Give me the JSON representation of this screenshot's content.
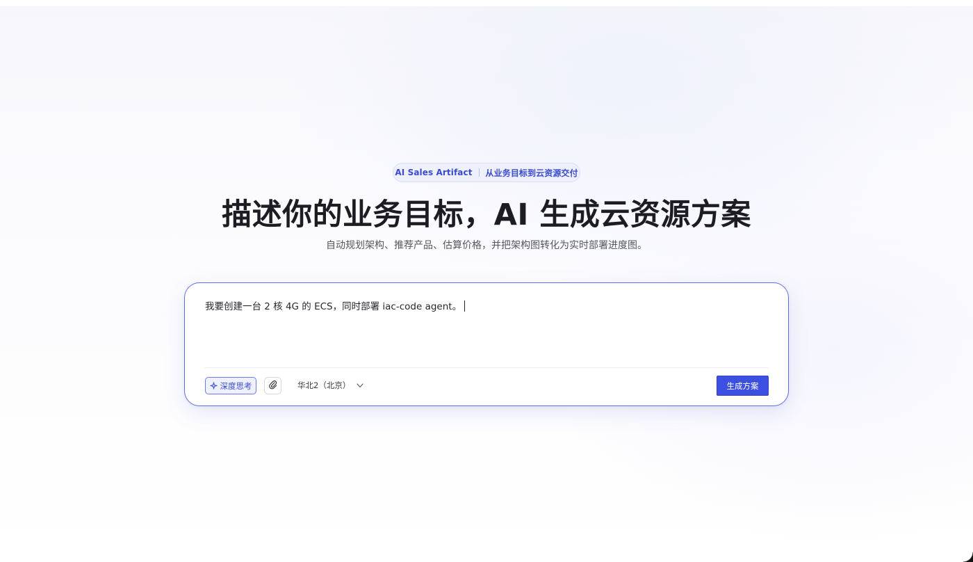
{
  "hero": {
    "pill": {
      "brand": "AI Sales Artifact",
      "tagline": "从业务目标到云资源交付"
    },
    "title": "描述你的业务目标，AI 生成云资源方案",
    "subtitle": "自动规划架构、推荐产品、估算价格，并把架构图转化为实时部署进度图。"
  },
  "composer": {
    "prompt_value": "我要创建一台 2 核 4G 的 ECS，同时部署 iac-code agent。",
    "deep_think_label": "深度思考",
    "region_selected": "华北2（北京）",
    "generate_label": "生成方案"
  },
  "icons": {
    "deep_think": "sparkle-icon",
    "attach": "paperclip-icon",
    "region_dropdown": "chevron-down-icon"
  },
  "colors": {
    "accent": "#3d4fe0",
    "composer_border": "#5d6ee6",
    "pill_background": "#eef0fb",
    "pill_text": "#3a4bd0"
  }
}
